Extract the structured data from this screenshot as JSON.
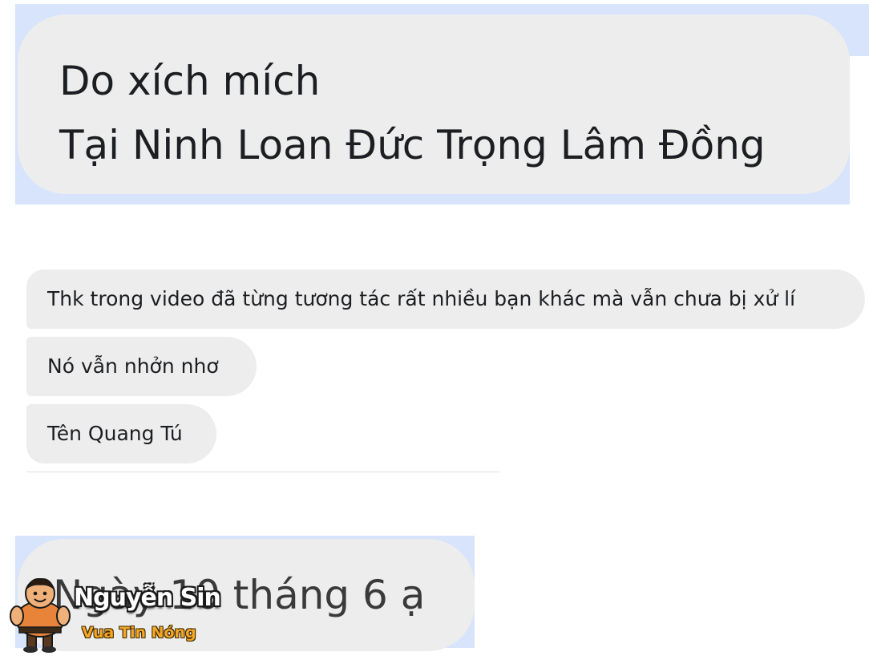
{
  "top_message": {
    "line1": "Do xích mích",
    "line2": "Tại Ninh Loan Đức Trọng Lâm Đồng"
  },
  "messages": [
    {
      "text": "Thk trong video đã từng tương tác rất nhiều bạn khác mà vẫn chưa bị xử lí"
    },
    {
      "text": "Nó vẫn nhởn nhơ"
    },
    {
      "text": "Tên Quang Tú"
    }
  ],
  "bottom_message": {
    "text": "Ngày 10 tháng 6 ạ"
  },
  "watermark": {
    "name": "Nguyễn Sin",
    "tagline": "Vua Tin Nóng",
    "mascot_icon": "mascot-icon"
  },
  "colors": {
    "bubble": "#ededed",
    "highlight_band": "#d7e4fb",
    "text": "#1c1e21",
    "watermark_tagline": "#f5a524"
  }
}
